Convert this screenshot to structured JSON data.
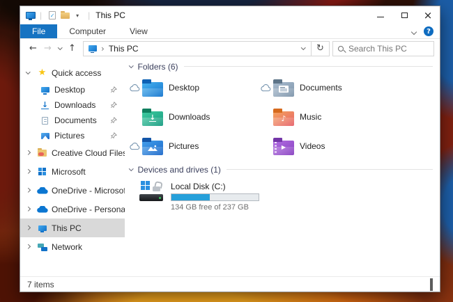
{
  "window": {
    "title": "This PC"
  },
  "ribbon": {
    "tabs": [
      "File",
      "Computer",
      "View"
    ]
  },
  "navbar": {
    "address": "This PC",
    "search_placeholder": "Search This PC"
  },
  "sidebar": {
    "items": [
      {
        "label": "Quick access"
      },
      {
        "label": "Desktop"
      },
      {
        "label": "Downloads"
      },
      {
        "label": "Documents"
      },
      {
        "label": "Pictures"
      },
      {
        "label": "Creative Cloud Files"
      },
      {
        "label": "Microsoft"
      },
      {
        "label": "OneDrive - Microsoft"
      },
      {
        "label": "OneDrive - Personal"
      },
      {
        "label": "This PC"
      },
      {
        "label": "Network"
      }
    ]
  },
  "content": {
    "folders_header": "Folders (6)",
    "folders": [
      {
        "label": "Desktop",
        "cloud_status": "online"
      },
      {
        "label": "Documents",
        "cloud_status": "online"
      },
      {
        "label": "Downloads"
      },
      {
        "label": "Music"
      },
      {
        "label": "Pictures",
        "cloud_status": "online"
      },
      {
        "label": "Videos"
      }
    ],
    "devices_header": "Devices and drives (1)",
    "drive": {
      "name": "Local Disk (C:)",
      "free_text": "134 GB free of 237 GB",
      "used_percent": 44
    }
  },
  "statusbar": {
    "items_text": "7 items"
  },
  "colors": {
    "accent": "#1673c2",
    "selection": "#d9d9d9",
    "progress_fill": "#26a0da",
    "header_text": "#3a3f5c"
  }
}
